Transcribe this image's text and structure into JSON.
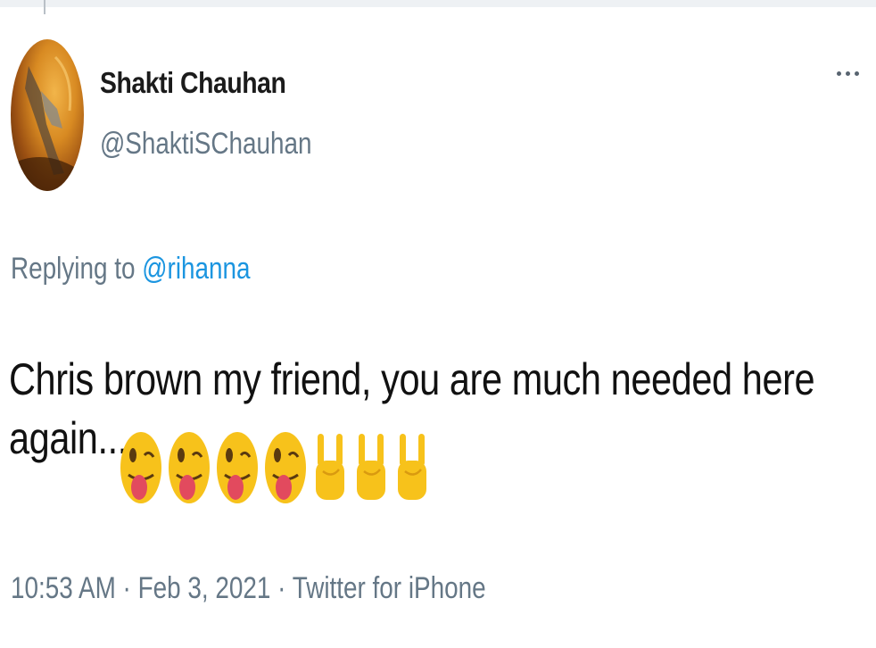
{
  "author": {
    "display_name": "Shakti Chauhan",
    "handle": "@ShaktiSChauhan",
    "avatar": "profile-photo-icon"
  },
  "menu": {
    "icon": "more-horizontal-icon"
  },
  "reply": {
    "prefix": "Replying to",
    "mention": "@rihanna"
  },
  "tweet": {
    "line1": "Chris brown my friend, you are much needed here",
    "line2": "again...",
    "emojis": [
      "winking-tongue-face-emoji",
      "winking-tongue-face-emoji",
      "winking-tongue-face-emoji",
      "winking-tongue-face-emoji",
      "sign-of-horns-emoji",
      "sign-of-horns-emoji",
      "sign-of-horns-emoji"
    ]
  },
  "meta": {
    "time": "10:53 AM",
    "separator": "·",
    "date": "Feb 3, 2021",
    "source": "Twitter for iPhone"
  },
  "colors": {
    "link": "#1b95e0",
    "secondary_text": "#657786",
    "primary_text": "#111111",
    "emoji_yellow": "#f7c21b"
  }
}
